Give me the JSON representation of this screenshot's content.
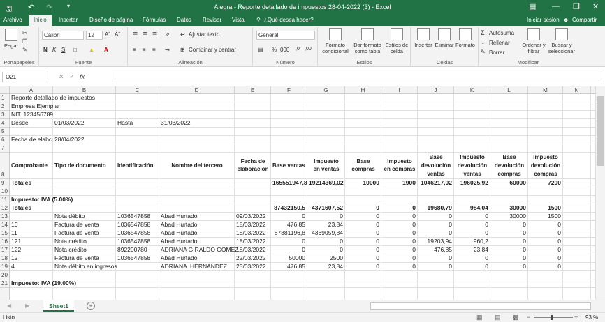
{
  "window": {
    "title": "Alegra - Reporte detallado de impuestos 28-04-2022 (3) - Excel",
    "signin": "Iniciar sesión",
    "share": "Compartir"
  },
  "tabs": [
    "Archivo",
    "Inicio",
    "Insertar",
    "Diseño de página",
    "Fórmulas",
    "Datos",
    "Revisar",
    "Vista"
  ],
  "tell_me": "¿Qué desea hacer?",
  "ribbon": {
    "paste": "Pegar",
    "clipboard": "Portapapeles",
    "font_name": "Calibri",
    "font_size": "12",
    "font_group": "Fuente",
    "wrap_text": "Ajustar texto",
    "merge_center": "Combinar y centrar",
    "alignment": "Alineación",
    "number_format": "General",
    "number_group": "Número",
    "cond_format": "Formato condicional",
    "format_table": "Dar formato como tabla",
    "cell_styles": "Estilos de celda",
    "styles_group": "Estilos",
    "insert": "Insertar",
    "delete": "Eliminar",
    "format": "Formato",
    "cells_group": "Celdas",
    "autosum": "Autosuma",
    "fill": "Rellenar",
    "clear": "Borrar",
    "sort_filter": "Ordenar y filtrar",
    "find_select": "Buscar y seleccionar",
    "editing_group": "Modificar"
  },
  "formula_bar": {
    "name_box": "O21",
    "content": ""
  },
  "columns": [
    "A",
    "B",
    "C",
    "D",
    "E",
    "F",
    "G",
    "H",
    "I",
    "J",
    "K",
    "L",
    "M",
    "N"
  ],
  "row_numbers": [
    "1",
    "2",
    "3",
    "4",
    "5",
    "6",
    "7",
    "8",
    "9",
    "10",
    "11",
    "12",
    "13",
    "14",
    "15",
    "16",
    "17",
    "18",
    "19",
    "20",
    "21"
  ],
  "cells": {
    "r1": "Reporte detallado de impuestos",
    "r2": "Empresa Ejemplar",
    "r3": "NIT. 123456789",
    "r4a": "Desde",
    "r4b": "01/03/2022",
    "r4c": "Hasta",
    "r4d": "31/03/2022",
    "r6a": "Fecha de elabc",
    "r6b": "28/04/2022",
    "h_a": "Comprobante",
    "h_b": "Tipo de documento",
    "h_c": "Identificación",
    "h_d": "Nombre del tercero",
    "h_e1": "Fecha de",
    "h_e2": "elaboración",
    "h_f": "Base ventas",
    "h_g1": "Impuesto",
    "h_g2": "en ventas",
    "h_h1": "Base",
    "h_h2": "compras",
    "h_i1": "Impuesto",
    "h_i2": "en compras",
    "h_j1": "Base",
    "h_j2": "devolución",
    "h_j3": "ventas",
    "h_k1": "Impuesto",
    "h_k2": "devolución",
    "h_k3": "ventas",
    "h_l1": "Base",
    "h_l2": "devolución",
    "h_l3": "compras",
    "h_m1": "Impuesto",
    "h_m2": "devolución",
    "h_m3": "compras",
    "r9a": "Totales",
    "r9f": "165551947,8",
    "r9g": "19214369,02",
    "r9h": "10000",
    "r9i": "1900",
    "r9j": "1046217,02",
    "r9k": "196025,92",
    "r9l": "60000",
    "r9m": "7200",
    "r11a": "Impuesto: IVA (5.00%)",
    "r12a": "Totales",
    "r12f": "87432150,5",
    "r12g": "4371607,52",
    "r12h": "0",
    "r12i": "0",
    "r12j": "19680,79",
    "r12k": "984,04",
    "r12l": "30000",
    "r12m": "1500",
    "r21a": "Impuesto: IVA (19.00%)"
  },
  "rows": [
    {
      "a": "",
      "b": "Nota débito",
      "c": "1036547858",
      "d": "Abad Hurtado",
      "e": "09/03/2022",
      "f": "0",
      "g": "0",
      "h": "0",
      "i": "0",
      "j": "0",
      "k": "0",
      "l": "30000",
      "m": "1500"
    },
    {
      "a": "10",
      "b": "Factura de venta",
      "c": "1036547858",
      "d": "Abad Hurtado",
      "e": "18/03/2022",
      "f": "476,85",
      "g": "23,84",
      "h": "0",
      "i": "0",
      "j": "0",
      "k": "0",
      "l": "0",
      "m": "0"
    },
    {
      "a": "11",
      "b": "Factura de venta",
      "c": "1036547858",
      "d": "Abad Hurtado",
      "e": "18/03/2022",
      "f": "87381196,8",
      "g": "4369059,84",
      "h": "0",
      "i": "0",
      "j": "0",
      "k": "0",
      "l": "0",
      "m": "0"
    },
    {
      "a": "121",
      "b": "Nota crédito",
      "c": "1036547858",
      "d": "Abad Hurtado",
      "e": "18/03/2022",
      "f": "0",
      "g": "0",
      "h": "0",
      "i": "0",
      "j": "19203,94",
      "k": "960,2",
      "l": "0",
      "m": "0"
    },
    {
      "a": "122",
      "b": "Nota crédito",
      "c": "892200780",
      "d": "ADRIANA GIRALDO GOMEZ",
      "e": "18/03/2022",
      "f": "0",
      "g": "0",
      "h": "0",
      "i": "0",
      "j": "476,85",
      "k": "23,84",
      "l": "0",
      "m": "0"
    },
    {
      "a": "12",
      "b": "Factura de venta",
      "c": "1036547858",
      "d": "Abad Hurtado",
      "e": "22/03/2022",
      "f": "50000",
      "g": "2500",
      "h": "0",
      "i": "0",
      "j": "0",
      "k": "0",
      "l": "0",
      "m": "0"
    },
    {
      "a": "4",
      "b": "Nota débito en ingresos",
      "c": "",
      "d": "ADRIANA .HERNANDEZ",
      "e": "25/03/2022",
      "f": "476,85",
      "g": "23,84",
      "h": "0",
      "i": "0",
      "j": "0",
      "k": "0",
      "l": "0",
      "m": "0"
    }
  ],
  "sheet_tab": "Sheet1",
  "status": {
    "ready": "Listo",
    "zoom": "93 %"
  }
}
